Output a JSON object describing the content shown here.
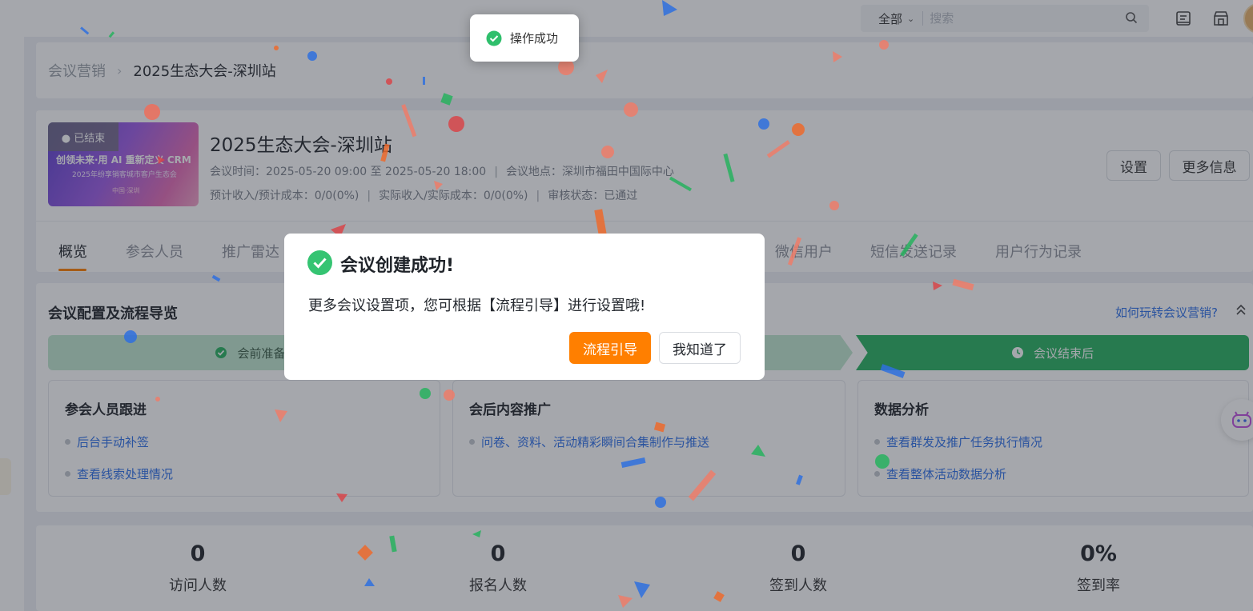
{
  "topbar": {
    "scope_label": "全部",
    "search_placeholder": "搜索"
  },
  "breadcrumb": {
    "parent": "会议营销",
    "current": "2025生态大会-深圳站"
  },
  "meeting": {
    "cover_badge": "● 已结束",
    "cover_line1": "创领未来·用 AI 重新定义 CRM",
    "cover_line2": "2025年纷享销客城市客户生态会",
    "cover_line3": "中国·深圳",
    "title": "2025生态大会-深圳站",
    "time_label": "会议时间：",
    "time_value": "2025-05-20 09:00 至 2025-05-20 18:00",
    "location_label": "会议地点：",
    "location_value": "深圳市福田中国际中心",
    "expected_label": "预计收入/预计成本：",
    "expected_value": "0/0(0%)",
    "actual_label": "实际收入/实际成本：",
    "actual_value": "0/0(0%)",
    "review_label": "审核状态：",
    "review_value": "已通过",
    "settings_button": "设置",
    "more_info_button": "更多信息"
  },
  "tabs": [
    {
      "label": "概览"
    },
    {
      "label": "参会人员"
    },
    {
      "label": "推广雷达"
    },
    {
      "label": "微信用户"
    },
    {
      "label": "短信发送记录"
    },
    {
      "label": "用户行为记录"
    }
  ],
  "config": {
    "title": "会议配置及流程导览",
    "help_link": "如何玩转会议营销?",
    "steps": [
      {
        "label": "会前准备"
      },
      {
        "label": ""
      },
      {
        "label": "会议结束后"
      }
    ],
    "cards": [
      {
        "title": "参会人员跟进",
        "links": [
          "后台手动补签",
          "查看线索处理情况"
        ]
      },
      {
        "title": "会后内容推广",
        "links": [
          "问卷、资料、活动精彩瞬间合集制作与推送"
        ]
      },
      {
        "title": "数据分析",
        "links": [
          "查看群发及推广任务执行情况",
          "查看整体活动数据分析"
        ]
      }
    ]
  },
  "stats": [
    {
      "value": "0",
      "label": "访问人数"
    },
    {
      "value": "0",
      "label": "报名人数"
    },
    {
      "value": "0",
      "label": "签到人数"
    },
    {
      "value": "0%",
      "label": "签到率"
    }
  ],
  "toast": {
    "text": "操作成功"
  },
  "dialog": {
    "title": "会议创建成功!",
    "message": "更多会议设置项，您可根据【流程引导】进行设置哦!",
    "primary_button": "流程引导",
    "secondary_button": "我知道了"
  },
  "colors": {
    "accent": "#ff7f00",
    "link": "#2c6fe8",
    "success": "#27b25f"
  }
}
